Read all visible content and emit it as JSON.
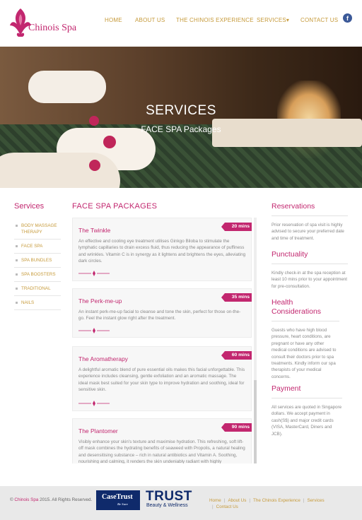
{
  "brand": {
    "logo_text": "Chinois Spa"
  },
  "nav": {
    "items": [
      "HOME",
      "ABOUT US",
      "THE CHINOIS EXPERIENCE",
      "SERVICES",
      "CONTACT US"
    ],
    "services_caret": "▾",
    "facebook_glyph": "f"
  },
  "hero": {
    "title": "SERVICES",
    "subtitle": "FACE SPA Packages"
  },
  "sidebar": {
    "title": "Services",
    "items": [
      "BODY MASSAGE THERAPY",
      "FACE SPA",
      "SPA BUNDLES",
      "SPA BOOSTERS",
      "TRADITIONAL",
      "NAILS"
    ]
  },
  "main": {
    "title": "FACE SPA PACKAGES",
    "packages": [
      {
        "name": "The Twinkle",
        "duration": "20 mins",
        "description": "An effective and cooling eye treatment utilises Ginkgo Biloba to stimulate the lymphatic capillaries to drain excess fluid, thus reducing the appearance of puffiness and wrinkles. Vitamin C is in synergy as it lightens and brightens the eyes, alleviating dark circles."
      },
      {
        "name": "The Perk-me-up",
        "duration": "35 mins",
        "description": "An instant perk-me-up facial to cleanse and tone the skin, perfect for those on-the-go. Feel the instant glow right after the treatment."
      },
      {
        "name": "The Aromatherapy",
        "duration": "60 mins",
        "description": "A delightful aromatic blend of pure essential oils makes this facial unforgettable. This experience includes cleansing, gentle exfoliation and an aromatic massage. The ideal mask best suited for your skin type to improve hydration and soothing, ideal for sensitive skin."
      },
      {
        "name": "The Plantomer",
        "duration": "90 mins",
        "description": "Visibly enhance your skin's texture and maximise hydration. This refreshing, soft lift-off mask combines the hydrating benefits of seaweed with Propolis, a natural healing and desensitising substance – rich in natural antibiotics and Vitamin A. Soothing, nourishing and calming, it renders the skin undeniably radiant with highly"
      }
    ]
  },
  "info": {
    "blocks": [
      {
        "title": "Reservations",
        "text": "Prior reservation of spa visit is highly advised to secure your preferred date and time of treatment."
      },
      {
        "title": "Punctuality",
        "text": "Kindly check-in at the spa reception at least 10 mins prior to your appointment for pre-consultation."
      },
      {
        "title": "Health Considerations",
        "text": "Guests who have high blood pressure, heart conditions, are pregnant or have any other medical conditions are advised to consult their doctors prior to spa treatments. Kindly inform our spa therapists of your medical concerns."
      },
      {
        "title": "Payment",
        "text": "All services are quoted in Singapore dollars. We accept payment in cash(S$) and major credit cards (VISA, MasterCard, Diners and JCB)."
      }
    ]
  },
  "footer": {
    "copyright_symbol": "©",
    "copyright_brand": "Chinois Spa",
    "copyright_rest": "2015. All Rights Reserved.",
    "casetrust_label": "CaseTrust",
    "casetrust_tag": "Be Sure",
    "trust_big": "TRUST",
    "trust_small": "Beauty & Wellness",
    "links": [
      "Home",
      "About Us",
      "The Chinois Experience",
      "Services",
      "Contact Us"
    ]
  },
  "colors": {
    "accent": "#c2276f",
    "gold": "#c69a3a",
    "footer_bg": "#e9e9e9",
    "badge": "#c2276f"
  }
}
